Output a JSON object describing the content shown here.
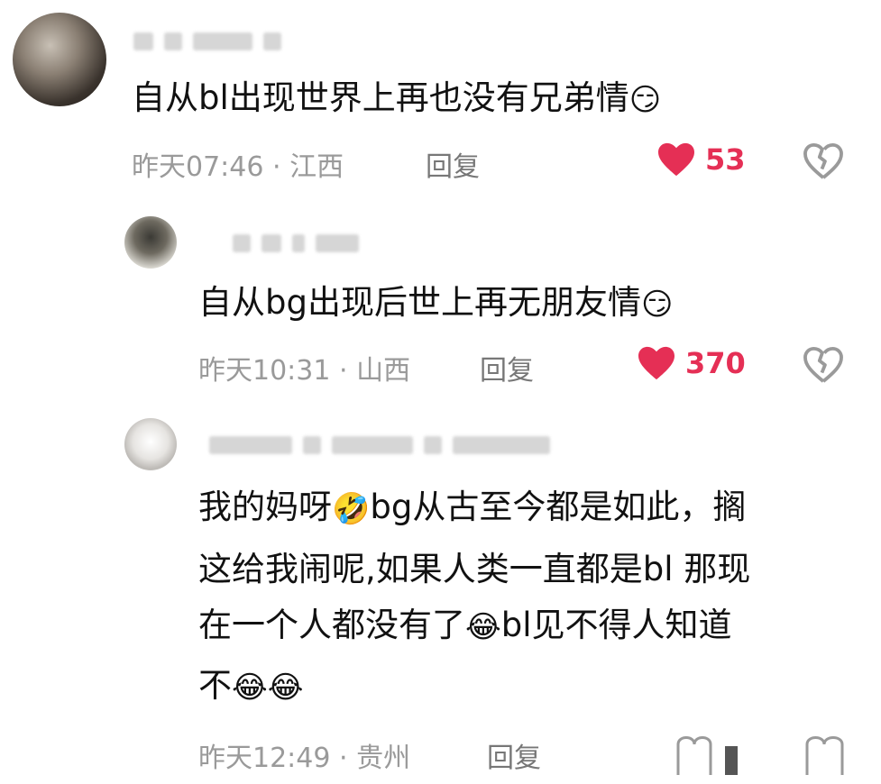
{
  "comments": [
    {
      "text": "自从bl出现世界上再也没有兄弟情",
      "emoji": "😏",
      "time": "昨天07:46",
      "location": "江西",
      "reply_label": "回复",
      "likes": "53"
    },
    {
      "text": "自从bg出现后世上再无朋友情",
      "emoji": "😏",
      "time": "昨天10:31",
      "location": "山西",
      "reply_label": "回复",
      "likes": "370"
    },
    {
      "line1_a": "我的妈呀",
      "line1_emoji": "🤣",
      "line1_b": "bg从古至今都是如此，搁",
      "line2": "这给我闹呢,如果人类一直都是bl 那现",
      "line3_a": "在一个人都没有了",
      "line3_emoji": "😂",
      "line3_b": "bl见不得人知道",
      "line4_a": "不",
      "line4_emojis": "😂😂",
      "time": "昨天12:49",
      "location": "贵州",
      "reply_label": "回复"
    }
  ],
  "separator": "·",
  "colors": {
    "like": "#e52f55",
    "meta": "#9a9a9a"
  }
}
